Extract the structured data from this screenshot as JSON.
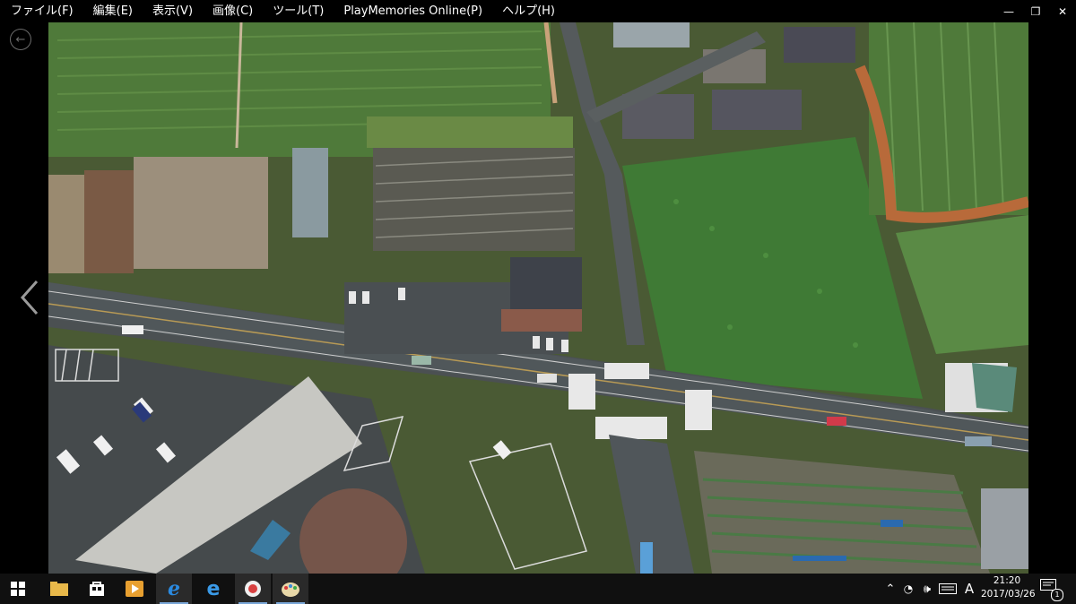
{
  "menu": [
    {
      "label": "ファイル(F)"
    },
    {
      "label": "編集(E)"
    },
    {
      "label": "表示(V)"
    },
    {
      "label": "画像(C)"
    },
    {
      "label": "ツール(T)"
    },
    {
      "label": "PlayMemories Online(P)"
    },
    {
      "label": "ヘルプ(H)"
    }
  ],
  "window_controls": {
    "minimize": "—",
    "restore": "❐",
    "close": "✕"
  },
  "back_button": {
    "glyph": "←"
  },
  "photo": {
    "subject": "aerial-drone-photo-intersection"
  },
  "taskbar": {
    "apps": [
      "start-button",
      "file-explorer",
      "store",
      "media-player",
      "internet-explorer",
      "edge",
      "playmemories-home",
      "paint"
    ],
    "ime_indicator": "A",
    "clock_time": "21:20",
    "clock_date": "2017/03/26",
    "notification_count": "1"
  },
  "colors": {
    "accent": "#7aa7d8",
    "taskbar": "#101010",
    "menubar": "#000000"
  }
}
